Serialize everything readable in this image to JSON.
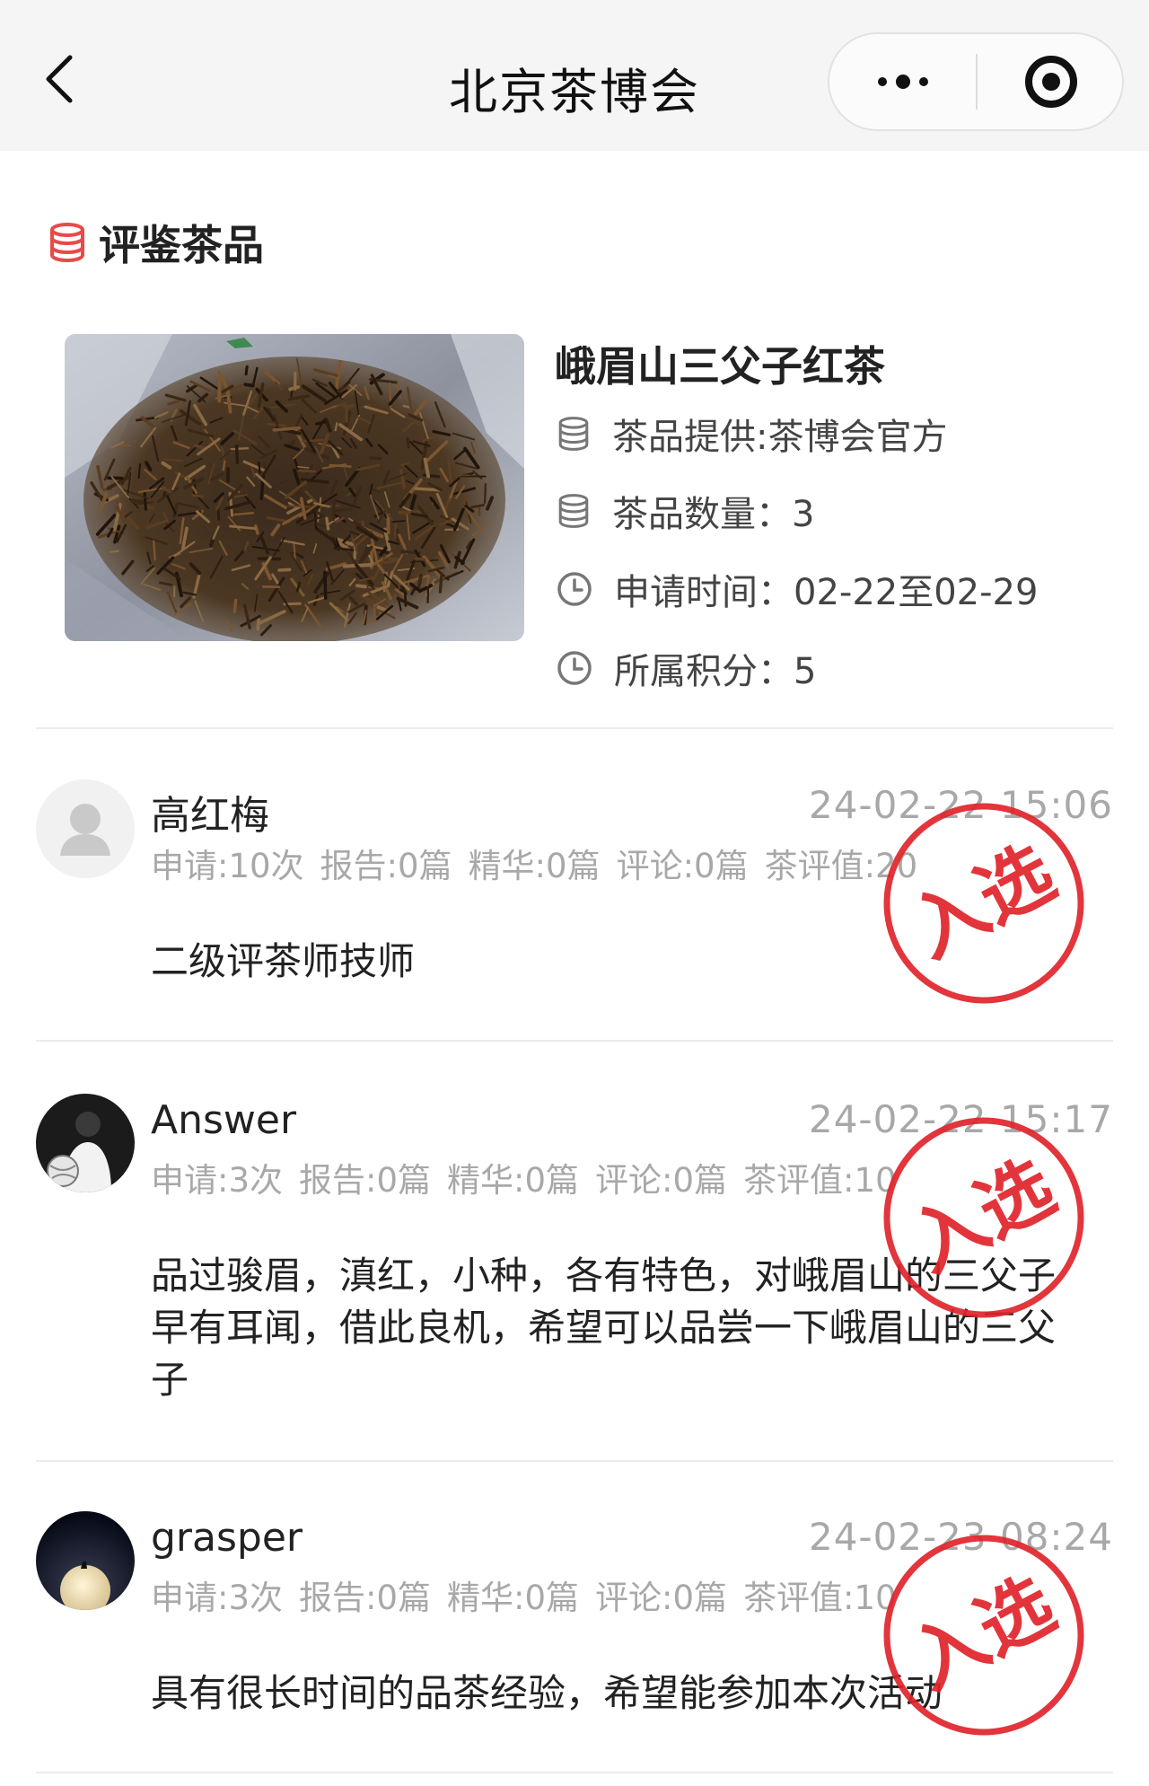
{
  "nav": {
    "title": "北京茶博会",
    "back_icon": "chevron-left-icon",
    "more_icon": "more-dots-icon",
    "target_icon": "target-circle-icon"
  },
  "section": {
    "title": "评鉴茶品",
    "icon": "database-stack-icon",
    "icon_color": "#e84a4a"
  },
  "tea": {
    "name": "峨眉山三父子红茶",
    "provider": "茶品提供:茶博会官方",
    "quantity": "茶品数量：3",
    "apply_time": "申请时间：02-22至02-29",
    "points": "所属积分：5"
  },
  "stamp": {
    "text": "入选",
    "color": "#e0242b"
  },
  "applicants": [
    {
      "name": "高红梅",
      "time": "24-02-22 15:06",
      "stats": [
        "申请:10次",
        "报告:0篇",
        "精华:0篇",
        "评论:0篇",
        "茶评值:20"
      ],
      "note": "二级评茶师技师",
      "avatar": "default-avatar-icon"
    },
    {
      "name": "Answer",
      "time": "24-02-22 15:17",
      "stats": [
        "申请:3次",
        "报告:0篇",
        "精华:0篇",
        "评论:0篇",
        "茶评值:10"
      ],
      "note": "品过骏眉，滇红，小种，各有特色，对峨眉山的三父子早有耳闻，借此良机，希望可以品尝一下峨眉山的三父子",
      "avatar": "user-photo-avatar"
    },
    {
      "name": "grasper",
      "time": "24-02-23 08:24",
      "stats": [
        "申请:3次",
        "报告:0篇",
        "精华:0篇",
        "评论:0篇",
        "茶评值:10"
      ],
      "note": "具有很长时间的品茶经验，希望能参加本次活动",
      "avatar": "moon-photo-avatar"
    }
  ]
}
